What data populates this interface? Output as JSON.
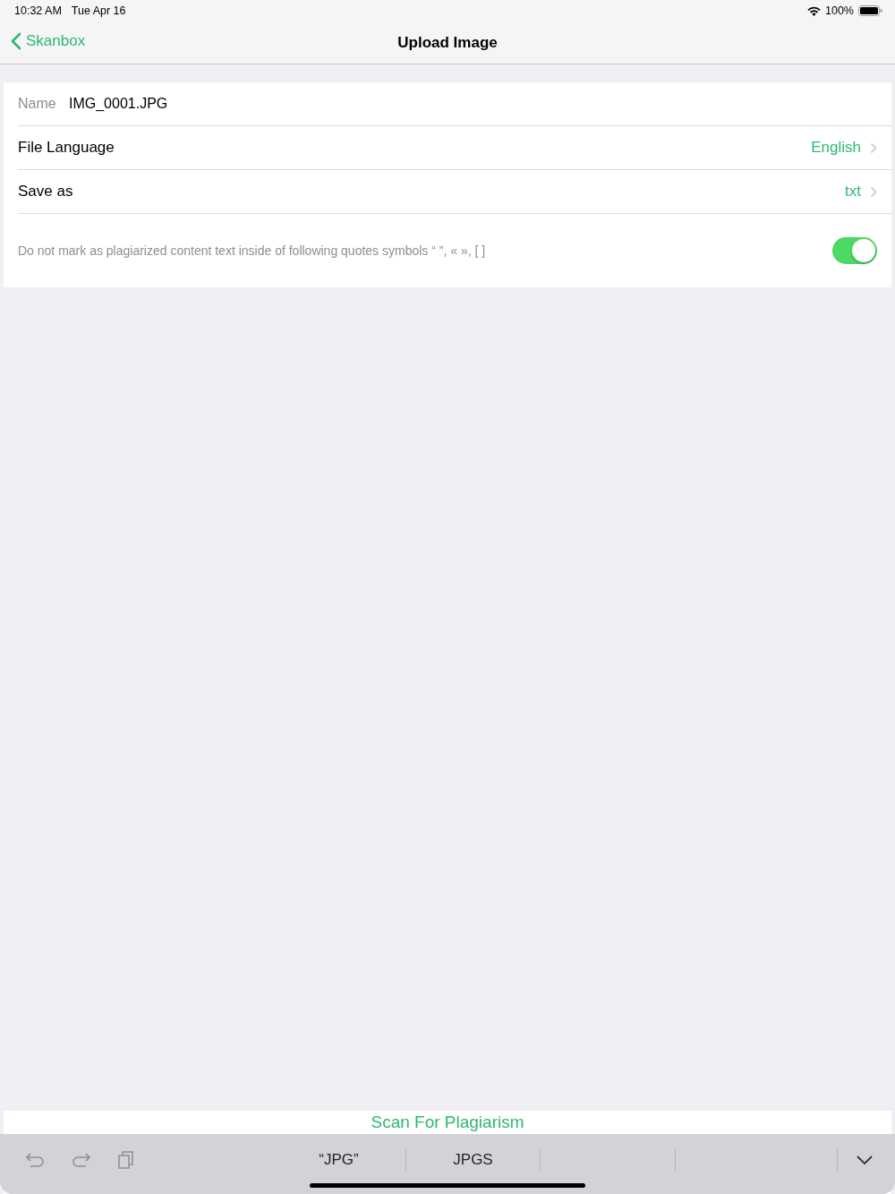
{
  "status_bar": {
    "time": "10:32 AM",
    "date": "Tue Apr 16",
    "battery": "100%"
  },
  "nav": {
    "back": "Skanbox",
    "title": "Upload Image"
  },
  "form": {
    "name": {
      "label": "Name",
      "value": "IMG_0001.JPG"
    },
    "rows": [
      {
        "label": "File Language",
        "value": "English"
      },
      {
        "label": "Save as",
        "value": "txt"
      }
    ],
    "option": {
      "text": "Do not mark as plagiarized content text inside of following quotes symbols “ ”, « », [ ]",
      "on": true
    }
  },
  "action_button": "Scan For Plagiarism",
  "keyboard_bar": {
    "suggestions": [
      "“JPG”",
      "JPGS"
    ]
  }
}
